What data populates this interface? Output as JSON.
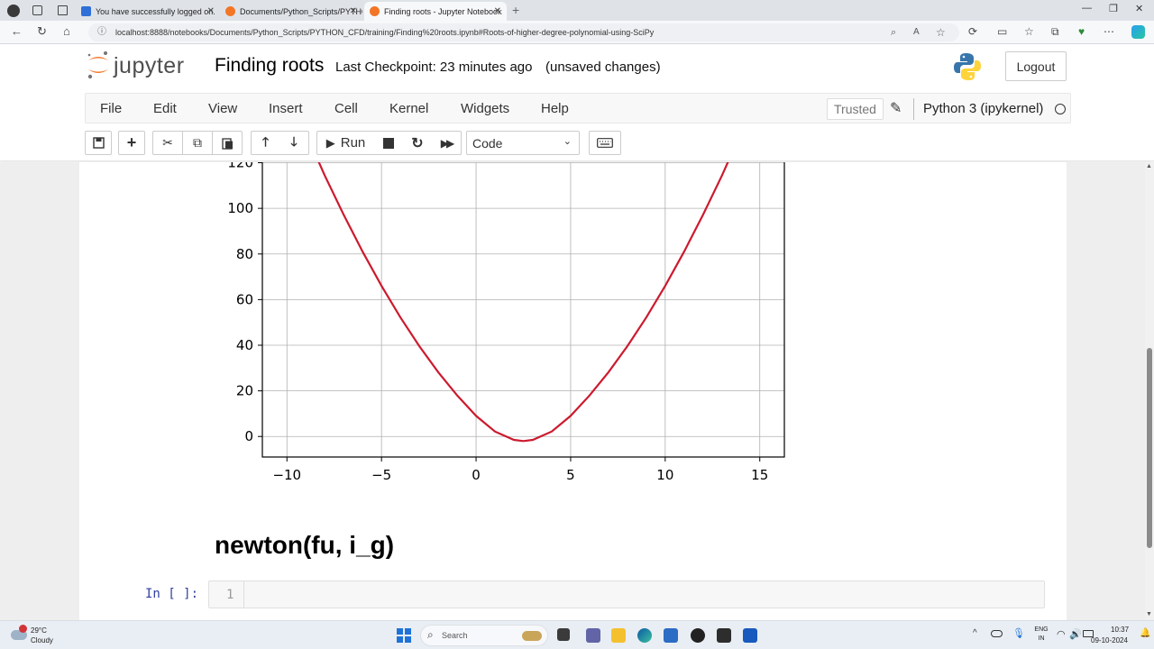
{
  "browser": {
    "tabs": [
      {
        "title": "You have successfully logged on.",
        "color": "#2f6fd8"
      },
      {
        "title": "Documents/Python_Scripts/PYTHON",
        "color": "#f37626"
      },
      {
        "title": "Finding roots - Jupyter Notebook",
        "color": "#f37626",
        "active": true
      }
    ],
    "url": "localhost:8888/notebooks/Documents/Python_Scripts/PYTHON_CFD/training/Finding%20roots.ipynb#Roots-of-higher-degree-polynomial-using-SciPy"
  },
  "jupyter": {
    "logo_text": "jupyter",
    "notebook_title": "Finding roots",
    "checkpoint": "Last Checkpoint: 23 minutes ago",
    "unsaved": "(unsaved changes)",
    "logout_label": "Logout",
    "menu": [
      "File",
      "Edit",
      "View",
      "Insert",
      "Cell",
      "Kernel",
      "Widgets",
      "Help"
    ],
    "trusted_label": "Trusted",
    "kernel_name": "Python 3 (ipykernel)",
    "run_label": "Run",
    "cell_type": "Code"
  },
  "notebook": {
    "heading": "newton(fu, i_g)",
    "prompt": "In [ ]:",
    "line_number": "1"
  },
  "chart_data": {
    "type": "line",
    "xlim": [
      -11.3,
      16.3
    ],
    "ylim": [
      -9,
      121
    ],
    "xticks": [
      -10,
      -5,
      0,
      5,
      10,
      15
    ],
    "yticks": [
      0,
      20,
      40,
      60,
      80,
      100,
      120
    ],
    "xtick_labels": [
      "−10",
      "−5",
      "0",
      "5",
      "10",
      "15"
    ],
    "ytick_labels": [
      "0",
      "20",
      "40",
      "60",
      "80",
      "100",
      "120"
    ],
    "grid": true,
    "series": [
      {
        "color": "#cc1a2e",
        "x": [
          -9,
          -8,
          -7,
          -6,
          -5,
          -4,
          -3,
          -2,
          -1,
          0,
          1,
          2,
          2.5,
          3,
          4,
          5,
          6,
          7,
          8,
          9,
          10,
          11,
          12,
          13,
          14
        ],
        "y": [
          133.1,
          114.4,
          97.2,
          81.0,
          66.0,
          52.2,
          39.6,
          28.2,
          18.0,
          9.0,
          2.2,
          -1.5,
          -2.0,
          -1.5,
          2.2,
          9.0,
          18.0,
          28.2,
          39.6,
          52.2,
          66.0,
          81.0,
          97.2,
          114.4,
          133.1
        ]
      }
    ]
  },
  "taskbar": {
    "weather_temp": "29°C",
    "weather_desc": "Cloudy",
    "search_label": "Search",
    "lang": "ENG",
    "region": "IN",
    "time": "10:37",
    "date": "09-10-2024"
  }
}
